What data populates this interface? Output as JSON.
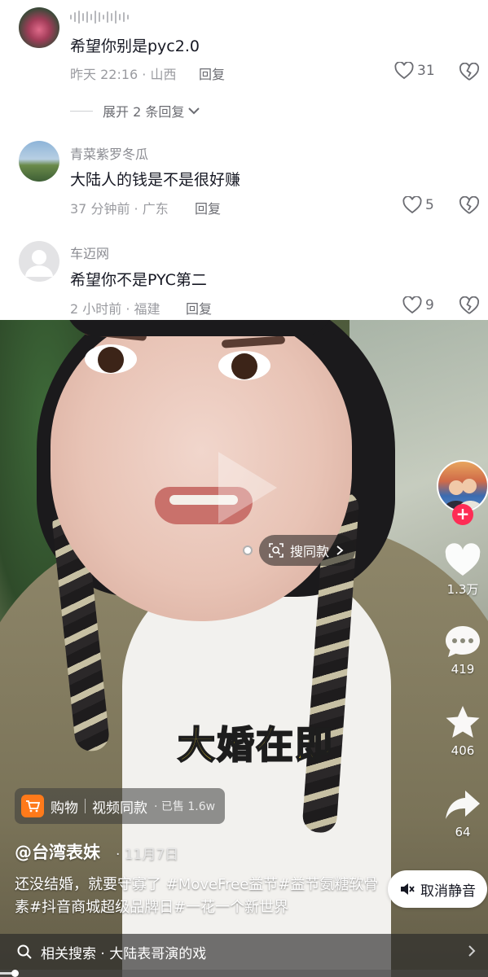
{
  "comments": [
    {
      "username": "",
      "has_voice": true,
      "text": "希望你别是pyc2.0",
      "meta": "昨天 22:16 · 山西",
      "reply_label": "回复",
      "likes": "31",
      "expand_label": "展开 2 条回复"
    },
    {
      "username": "青菜紫罗冬瓜",
      "text": "大陆人的钱是不是很好赚",
      "meta": "37 分钟前 · 广东",
      "reply_label": "回复",
      "likes": "5"
    },
    {
      "username": "车迈网",
      "text": "希望你不是PYC第二",
      "meta": "2 小时前 · 福建",
      "reply_label": "回复",
      "likes": "9"
    }
  ],
  "video": {
    "search_same_label": "搜同款",
    "caption_overlay": "大婚在即",
    "likes": "1.3万",
    "comments": "419",
    "favorites": "406",
    "shares": "64",
    "product": {
      "label": "购物",
      "title": "视频同款",
      "sold": "· 已售 1.6w"
    },
    "author": "@台湾表妹",
    "date": "· 11月7日",
    "description": "还没结婚，就要守寡了 #MoveFree益节#益节氨糖软骨素#抖音商城超级品牌日#一花一个新世界",
    "unmute_label": "取消静音",
    "related_search": "相关搜索 · 大陆表哥演的戏",
    "progress": 0.03
  },
  "colors": {
    "accent_red": "#fe2c55",
    "caption_yellow": "#ffe23b",
    "cart_orange": "#ff7a1a"
  }
}
